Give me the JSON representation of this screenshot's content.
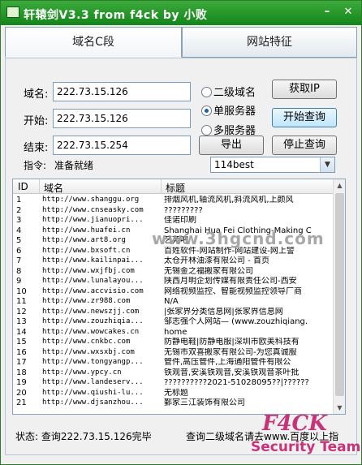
{
  "window": {
    "title": "轩辕剑V3.3 from f4ck by 小败"
  },
  "tabs": [
    {
      "label": "域名C段"
    },
    {
      "label": "网站特征"
    }
  ],
  "form": {
    "domain_label": "域名:",
    "domain_value": "222.73.15.126",
    "start_label": "开始:",
    "start_value": "222.73.15.126",
    "end_label": "结束:",
    "end_value": "222.73.15.254",
    "command_label": "指令:",
    "command_value": "准备就绪"
  },
  "radios": [
    {
      "label": "二级域名",
      "checked": false
    },
    {
      "label": "单服务器",
      "checked": true
    },
    {
      "label": "多服务器",
      "checked": false
    }
  ],
  "buttons": {
    "get_ip": "获取IP",
    "start_query": "开始查询",
    "export": "导出",
    "stop_query": "停止查询"
  },
  "engine_select": {
    "value": "114best"
  },
  "list": {
    "columns": [
      "ID",
      "域名",
      "标题"
    ],
    "rows": [
      {
        "id": "1",
        "domain": "http://www.shanggu.org",
        "title": "排烟风机,轴流风机,斜流风机,上颜风"
      },
      {
        "id": "2",
        "domain": "http://www.cnseasky.com",
        "title": "?????????"
      },
      {
        "id": "3",
        "domain": "http://www.jianuopri...",
        "title": "佳诺印刷"
      },
      {
        "id": "4",
        "domain": "http://www.huafei.cn",
        "title": "Shanghai Hua Fei Clothing-Making C"
      },
      {
        "id": "5",
        "domain": "http://www.art8.org",
        "title": "艺苑吧"
      },
      {
        "id": "6",
        "domain": "http://www.bxsoft.cn",
        "title": "百姓软件-网站制作-网站建设-网上警"
      },
      {
        "id": "7",
        "domain": "http://www.kailinpai...",
        "title": "太仓开林油漆有限公司 - 首页"
      },
      {
        "id": "8",
        "domain": "http://www.wxjfbj.com",
        "title": "无锡金之福搬家有限公司"
      },
      {
        "id": "9",
        "domain": "http://www.lunalayou...",
        "title": "陕西月明企划传媒有限责任公司-西安"
      },
      {
        "id": "10",
        "domain": "http://www.accvisio.com",
        "title": "网络视频监控、智能视频监控领导厂商"
      },
      {
        "id": "11",
        "domain": "http://www.zr988.com",
        "title": "N/A"
      },
      {
        "id": "12",
        "domain": "http://www.newszjj.com",
        "title": "|张家界分类信息网|张家界信息网"
      },
      {
        "id": "13",
        "domain": "http://www.zouzhiqia...",
        "title": "邹志强个人网站— (www.zouzhiqiang."
      },
      {
        "id": "14",
        "domain": "http://www.wowcakes.cn",
        "title": "home"
      },
      {
        "id": "15",
        "domain": "http://www.cnkbc.com",
        "title": "防静电鞋|防静电服|深圳市欧美科技有"
      },
      {
        "id": "16",
        "domain": "http://www.wxsxbj.com",
        "title": "无锡市双喜搬家有限公司-为您真诚服"
      },
      {
        "id": "17",
        "domain": "http://www.tongyangp...",
        "title": "管件,高压管件,上海通阳管件有限公"
      },
      {
        "id": "18",
        "domain": "http://www.ypcy.cn",
        "title": "铁观音,安溪铁观音,安溪铁观音茶叶批"
      },
      {
        "id": "19",
        "domain": "http://www.landeserv...",
        "title": "??????????2021-51028095??|??????"
      },
      {
        "id": "20",
        "domain": "http://www.qiushi-lu...",
        "title": "无标题"
      },
      {
        "id": "21",
        "domain": "http://www.djsanzhou...",
        "title": "鄞家三江装饰有限公司"
      }
    ]
  },
  "status": {
    "left": "状态: 查询222.73.15.126完毕",
    "right": "查询二级域名请去www.百度以上指"
  },
  "watermark": {
    "text": "www.3hgcnd.com"
  },
  "logo": {
    "line1": "F4CK",
    "line2": "Security Team"
  }
}
